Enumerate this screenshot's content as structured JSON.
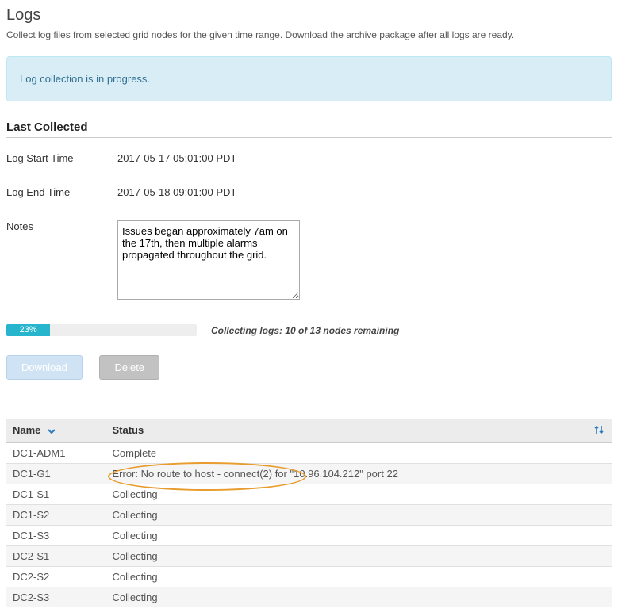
{
  "page": {
    "title": "Logs",
    "subtitle": "Collect log files from selected grid nodes for the given time range. Download the archive package after all logs are ready."
  },
  "banner": {
    "message": "Log collection is in progress."
  },
  "last_collected": {
    "heading": "Last Collected",
    "start_label": "Log Start Time",
    "start_value": "2017-05-17 05:01:00 PDT",
    "end_label": "Log End Time",
    "end_value": "2017-05-18 09:01:00 PDT",
    "notes_label": "Notes",
    "notes_value": "Issues began approximately 7am on the 17th, then multiple alarms propagated throughout the grid."
  },
  "progress": {
    "percent_label": "23%",
    "percent_width": "23%",
    "status_text": "Collecting logs: 10 of 13 nodes remaining"
  },
  "buttons": {
    "download": "Download",
    "delete": "Delete"
  },
  "table": {
    "headers": {
      "name": "Name",
      "status": "Status"
    },
    "rows": [
      {
        "name": "DC1-ADM1",
        "status": "Complete",
        "error": false
      },
      {
        "name": "DC1-G1",
        "status": "Error: No route to host - connect(2) for \"10.96.104.212\" port 22",
        "error": true
      },
      {
        "name": "DC1-S1",
        "status": "Collecting",
        "error": false
      },
      {
        "name": "DC1-S2",
        "status": "Collecting",
        "error": false
      },
      {
        "name": "DC1-S3",
        "status": "Collecting",
        "error": false
      },
      {
        "name": "DC2-S1",
        "status": "Collecting",
        "error": false
      },
      {
        "name": "DC2-S2",
        "status": "Collecting",
        "error": false
      },
      {
        "name": "DC2-S3",
        "status": "Collecting",
        "error": false
      }
    ]
  },
  "colors": {
    "banner_bg": "#d9edf7",
    "progress_fill": "#26b5cc",
    "highlight_border": "#e89c2d"
  }
}
